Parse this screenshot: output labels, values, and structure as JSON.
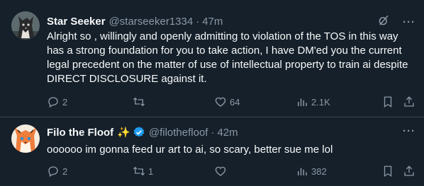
{
  "tweets": [
    {
      "author": "Star Seeker",
      "handle": "@starseeker1334",
      "separator": "·",
      "time": "47m",
      "text": "Alright so , willingly and openly admitting to violation of the TOS in this way has a strong foundation for you to take action, I have DM'ed you the current legal precedent on the matter of use of intellectual property to train ai despite DIRECT DISCLOSURE against it.",
      "replies": "2",
      "retweets": "",
      "likes": "64",
      "views": "2.1K",
      "more": "···",
      "avatar_colors": {
        "bg": "#6b7a7c",
        "fg": "#2b2b2b"
      }
    },
    {
      "author": "Filo the Floof",
      "sparkle": "✨",
      "handle": "@filothefloof",
      "separator": "·",
      "time": "42m",
      "text": "oooooo im gonna feed ur art to ai, so scary, better sue me lol",
      "replies": "2",
      "retweets": "1",
      "likes": "",
      "views": "382",
      "more": "···",
      "avatar_colors": {
        "bg": "#f3e6d4",
        "fg": "#e8733a"
      }
    }
  ],
  "colors": {
    "background": "#15202b",
    "text": "#f7f9f9",
    "muted": "#8b98a5",
    "border": "#38444d",
    "verified": "#1d9bf0"
  }
}
